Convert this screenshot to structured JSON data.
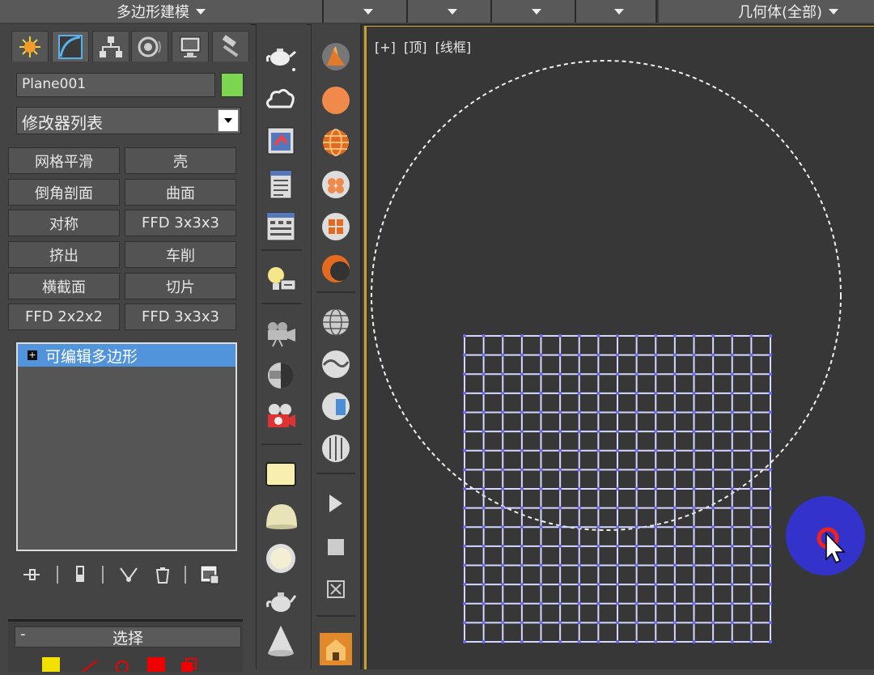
{
  "topbar": {
    "ribbon_title": "多边形建模",
    "geometry_filter": "几何体(全部)"
  },
  "command_panel": {
    "tabs": [
      "create-tab",
      "modify-tab",
      "hierarchy-tab",
      "motion-tab",
      "display-tab",
      "utilities-tab"
    ],
    "object_name": "Plane001",
    "object_color": "#7dd64f",
    "modifier_list": "修改器列表",
    "modifier_buttons": [
      "网格平滑",
      "壳",
      "倒角剖面",
      "曲面",
      "对称",
      "FFD 3x3x3",
      "挤出",
      "车削",
      "横截面",
      "切片",
      "FFD 2x2x2",
      "FFD 3x3x3"
    ],
    "stack_item": "可编辑多边形",
    "selection_title": "选择",
    "selection_collapse": "-"
  },
  "viewport": {
    "label_plus": "[+]",
    "label_view": "[顶]",
    "label_mode": "[线框]",
    "grid_color": "#6a6aff",
    "grid_rows": 16,
    "grid_cols": 16
  },
  "icons": {
    "col1": [
      "teapot-icon",
      "cloud-icon",
      "render-frame-icon",
      "document-icon",
      "calculator-icon",
      "light-icon",
      "camera-icon",
      "camera-sphere-icon",
      "video-camera-icon",
      "box-icon",
      "dome-icon",
      "sphere-icon",
      "teapot-icon",
      "cone-icon"
    ],
    "col2": [
      "rock-icon",
      "orange-sphere-icon",
      "globe-icon",
      "material-sphere-icon",
      "tile-sphere-icon",
      "crescent-icon",
      "wire-globe-icon",
      "wave-sphere-icon",
      "cut-sphere-icon",
      "striped-sphere-icon",
      "play-icon",
      "stop-icon",
      "close-box-icon",
      "house-icon"
    ]
  }
}
